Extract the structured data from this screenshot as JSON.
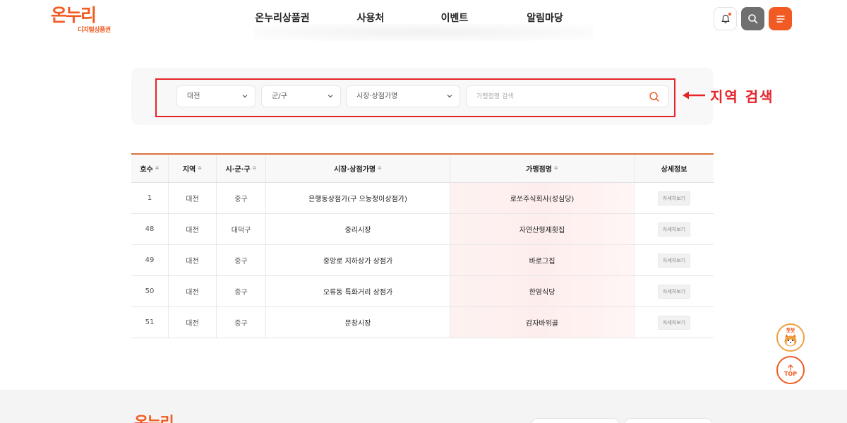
{
  "header": {
    "logo_main": "온누리",
    "logo_sub": "디지털상품권",
    "nav": [
      "온누리상품권",
      "사용처",
      "이벤트",
      "알림마당"
    ],
    "icons": {
      "bell": "bell-icon",
      "search": "search-icon",
      "menu": "hamburger-menu-icon"
    },
    "accent_color": "#f15a22"
  },
  "search": {
    "region_select": "대전",
    "district_select": "군/구",
    "market_select": "시장·상점가명",
    "store_placeholder": "가맹점명 검색",
    "store_value": ""
  },
  "annotation": {
    "text": "지역 검색",
    "color": "#e5242a"
  },
  "table": {
    "columns": [
      "호수",
      "지역",
      "시·군·구",
      "시장·상점가명",
      "가맹점명",
      "상세정보"
    ],
    "detail_label": "자세히보기",
    "rows": [
      {
        "no": "1",
        "region": "대전",
        "district": "중구",
        "market": "은행동상점가(구 으능정이상점가)",
        "store": "로쏘주식회사(성심당)"
      },
      {
        "no": "48",
        "region": "대전",
        "district": "대덕구",
        "market": "중리시장",
        "store": "자연산형제횟집"
      },
      {
        "no": "49",
        "region": "대전",
        "district": "중구",
        "market": "중앙로 지하상가 상점가",
        "store": "바로그집"
      },
      {
        "no": "50",
        "region": "대전",
        "district": "중구",
        "market": "오류동 특화거리 상점가",
        "store": "한영식당"
      },
      {
        "no": "51",
        "region": "대전",
        "district": "중구",
        "market": "문창시장",
        "store": "감자바위골"
      }
    ]
  },
  "floating": {
    "chatbot_label": "챗봇",
    "top_label": "TOP"
  },
  "footer": {
    "logo": "온누리"
  }
}
